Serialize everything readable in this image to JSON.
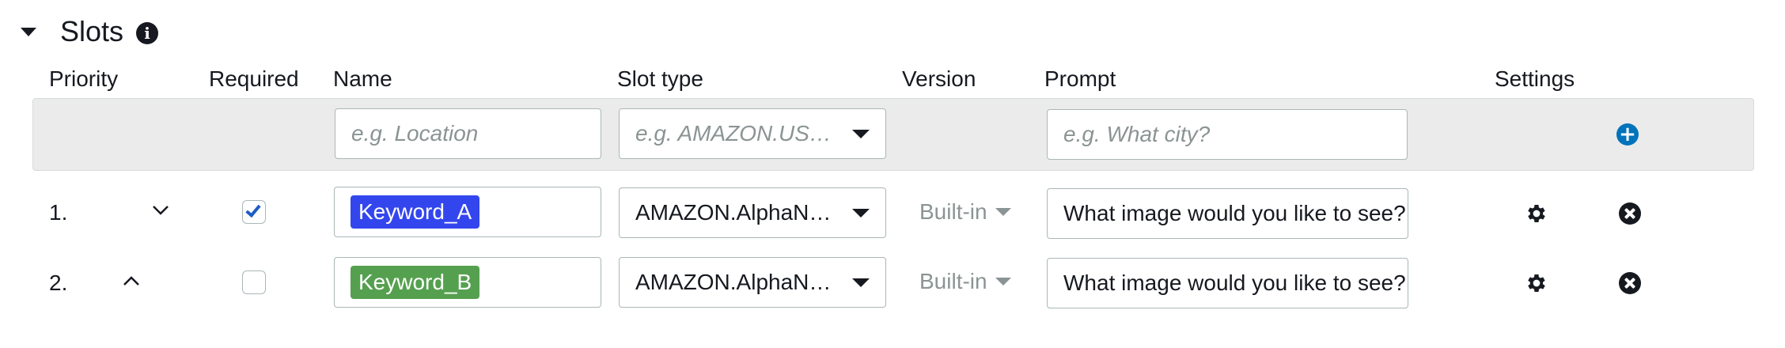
{
  "section": {
    "title": "Slots",
    "info_icon": "info-icon"
  },
  "columns": {
    "priority": "Priority",
    "required": "Required",
    "name": "Name",
    "slot_type": "Slot type",
    "version": "Version",
    "prompt": "Prompt",
    "settings": "Settings"
  },
  "new_slot": {
    "name_placeholder": "e.g. Location",
    "slot_type_placeholder": "e.g. AMAZON.US…",
    "prompt_placeholder": "e.g. What city?",
    "add_icon": "plus-circle-icon"
  },
  "rows": [
    {
      "priority": "1.",
      "move_icon": "chevron-down-icon",
      "required": true,
      "name": "Keyword_A",
      "name_color": "#3346ee",
      "slot_type": "AMAZON.AlphaN…",
      "version": "Built-in",
      "prompt": "What image would you like to see?"
    },
    {
      "priority": "2.",
      "move_icon": "chevron-up-icon",
      "required": false,
      "name": "Keyword_B",
      "name_color": "#55a04f",
      "slot_type": "AMAZON.AlphaN…",
      "version": "Built-in",
      "prompt": "What image would you like to see?"
    }
  ],
  "colors": {
    "accent": "#0073bb",
    "band": "#ebebeb",
    "border": "#aab7b8",
    "muted": "#8b9494"
  }
}
